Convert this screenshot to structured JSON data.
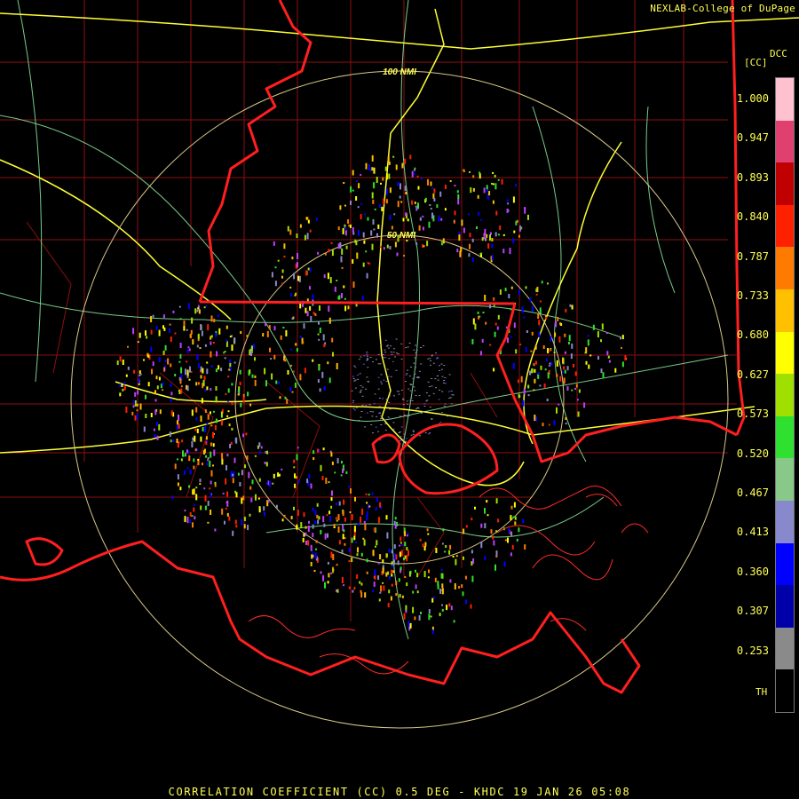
{
  "header": {
    "credit": "NEXLAB-College of DuPage"
  },
  "footer": {
    "caption": "CORRELATION COEFFICIENT (CC) 0.5 DEG - KHDC 19 JAN 26 05:08"
  },
  "range_rings": {
    "inner_label": "50 NMI",
    "outer_label": "100 NMI"
  },
  "colorbar": {
    "title": "DCC",
    "unit": "[CC]",
    "labels": [
      "1.000",
      "0.947",
      "0.893",
      "0.840",
      "0.787",
      "0.733",
      "0.680",
      "0.627",
      "0.573",
      "0.520",
      "0.467",
      "0.413",
      "0.360",
      "0.307",
      "0.253"
    ],
    "bottom_label": "TH",
    "colors": [
      "#ffc0d0",
      "#e04070",
      "#c00000",
      "#ff2000",
      "#ff7a00",
      "#ffc000",
      "#ffff00",
      "#a0e000",
      "#30e030",
      "#88c888",
      "#8888cc",
      "#0000ff",
      "#0000a8",
      "#8a8a8a",
      "#000000"
    ]
  },
  "colors": {
    "state_borders": "#ff1f1f",
    "counties": "#8b1010",
    "interstates": "#ffff33",
    "highways": "#77cc88",
    "range_rings": "#d8c888",
    "text": "#ffff55"
  }
}
